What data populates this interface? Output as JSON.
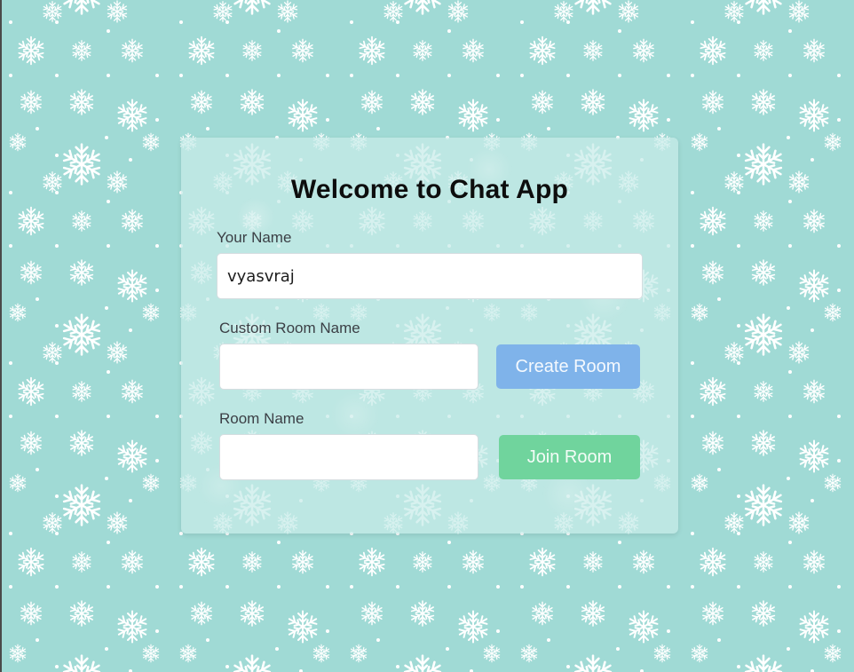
{
  "form": {
    "title": "Welcome to Chat App",
    "name_label": "Your Name",
    "name_value": "vyasvraj",
    "custom_room_label": "Custom Room Name",
    "custom_room_value": "",
    "create_button_label": "Create Room",
    "room_name_label": "Room Name",
    "room_name_value": "",
    "join_button_label": "Join Room"
  },
  "colors": {
    "background": "#a0dad5",
    "card": "#c8ebe9",
    "create_button": "#7fb3ea",
    "join_button": "#70d49d"
  },
  "icons": {
    "background_pattern": "snowflake-icon"
  }
}
